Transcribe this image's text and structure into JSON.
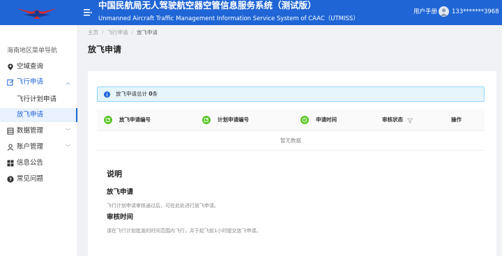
{
  "header": {
    "title": "中国民航局无人驾驶航空器空管信息服务系统（测试版）",
    "subtitle": "Unmanned Aircraft Traffic Management Information Service System of CAAC（UTMISS）",
    "user_manual": "用户手册",
    "phone": "133*******3968",
    "colors": {
      "bar": "#1f65d6",
      "logo_red": "#d9272e",
      "logo_blue": "#1a3a8c"
    }
  },
  "sidebar": {
    "title": "海南地区菜单导航",
    "items": [
      {
        "label": "空域查询",
        "icon": "location-pin-icon"
      },
      {
        "label": "飞行申请",
        "icon": "edit-form-icon",
        "expanded": true
      },
      {
        "label": "飞行计划申请"
      },
      {
        "label": "放飞申请",
        "selected": true
      },
      {
        "label": "数据管理",
        "icon": "database-icon"
      },
      {
        "label": "账户管理",
        "icon": "user-icon"
      },
      {
        "label": "信息公告",
        "icon": "grid-icon"
      },
      {
        "label": "常见问题",
        "icon": "question-circle-icon"
      }
    ]
  },
  "breadcrumb": [
    "主页",
    "飞行申请",
    "放飞申请"
  ],
  "page_title": "放飞申请",
  "alert": {
    "prefix": "放飞申请总计 ",
    "count": "0",
    "suffix": "条"
  },
  "table": {
    "columns": [
      "放飞申请编号",
      "计划申请编号",
      "申请时间",
      "审核状态",
      "操作"
    ],
    "empty_text": "暂无数据"
  },
  "description": {
    "title": "说明",
    "sections": [
      {
        "heading": "放飞申请",
        "text": "飞行计划申请审核通过后，可在此处进行放飞申请。"
      },
      {
        "heading": "审核时间",
        "text": "请在飞行计划批准的时间范围内飞行，并于起飞前1小时提交放飞申请。"
      }
    ]
  },
  "accent_color": "#1f65d6"
}
